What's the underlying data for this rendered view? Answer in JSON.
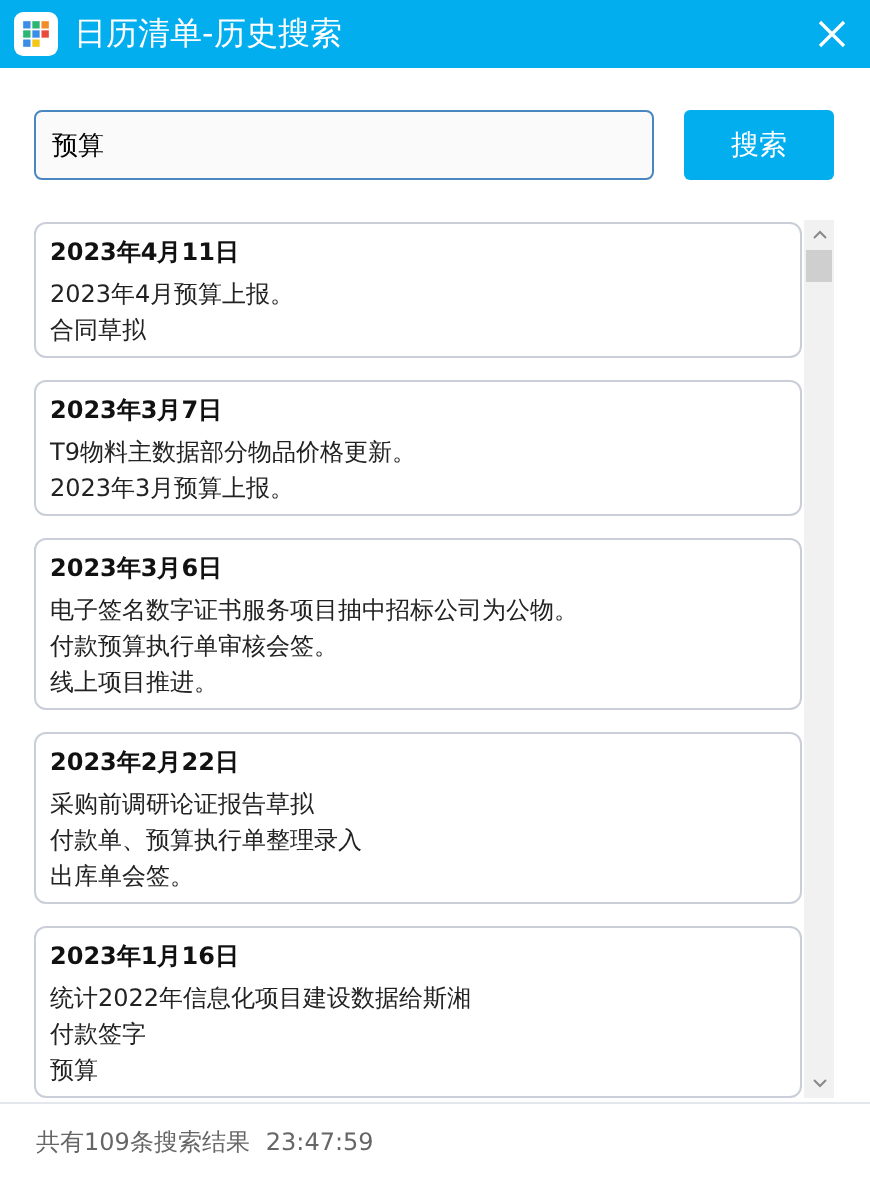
{
  "window": {
    "title": "日历清单-历史搜索"
  },
  "search": {
    "value": "预算",
    "button": "搜索"
  },
  "results": [
    {
      "date": "2023年4月11日",
      "lines": [
        "2023年4月预算上报。",
        "合同草拟"
      ]
    },
    {
      "date": "2023年3月7日",
      "lines": [
        "T9物料主数据部分物品价格更新。",
        "2023年3月预算上报。"
      ]
    },
    {
      "date": "2023年3月6日",
      "lines": [
        "电子签名数字证书服务项目抽中招标公司为公物。",
        "付款预算执行单审核会签。",
        "线上项目推进。"
      ]
    },
    {
      "date": "2023年2月22日",
      "lines": [
        "采购前调研论证报告草拟",
        "付款单、预算执行单整理录入",
        "出库单会签。"
      ]
    },
    {
      "date": "2023年1月16日",
      "lines": [
        "统计2022年信息化项目建设数据给斯湘",
        "付款签字",
        "预算"
      ]
    }
  ],
  "status_bar": {
    "summary": "共有109条搜索结果",
    "time": "23:47:59"
  }
}
